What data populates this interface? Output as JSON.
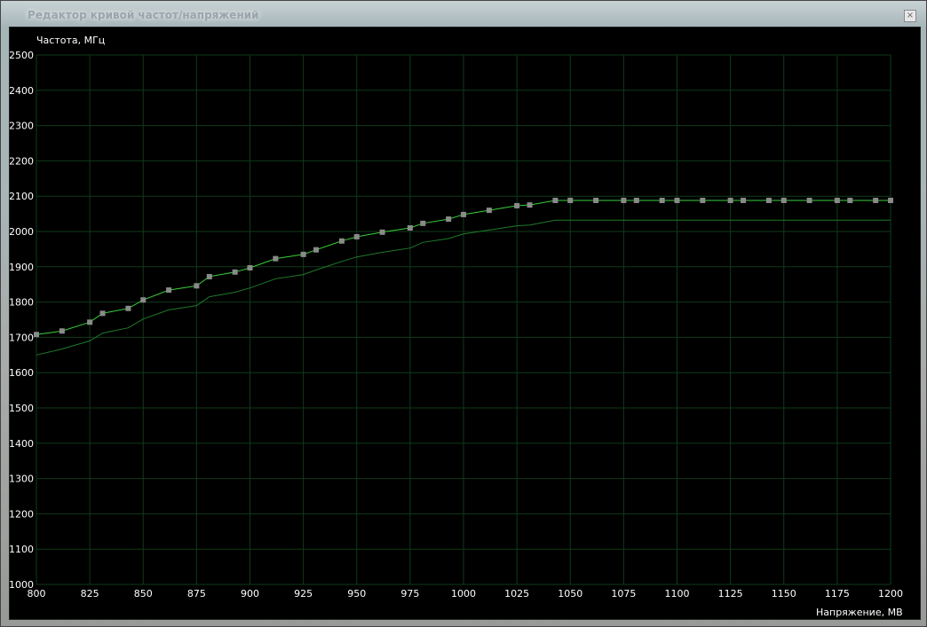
{
  "window": {
    "title": "Редактор кривой частот/напряжений",
    "close_glyph": "×"
  },
  "colors": {
    "background": "#000000",
    "grid": "#0f3a18",
    "main_curve": "#37d037",
    "base_curve": "#1f7a2a",
    "point": "#8a8a8a",
    "text": "#ffffff"
  },
  "chart_data": {
    "type": "line",
    "title": "",
    "ylabel": "Частота, МГц",
    "xlabel": "Напряжение, МВ",
    "xlim": [
      800,
      1200
    ],
    "ylim": [
      1000,
      2500
    ],
    "x_ticks": [
      800,
      825,
      850,
      875,
      900,
      925,
      950,
      975,
      1000,
      1025,
      1050,
      1075,
      1100,
      1125,
      1150,
      1175,
      1200
    ],
    "y_ticks": [
      1000,
      1100,
      1200,
      1300,
      1400,
      1500,
      1600,
      1700,
      1800,
      1900,
      2000,
      2100,
      2200,
      2300,
      2400,
      2500
    ],
    "grid": true,
    "series": [
      {
        "x": [
          800,
          812,
          825,
          831,
          843,
          850,
          862,
          875,
          881,
          893,
          900,
          912,
          925,
          931,
          943,
          950,
          962,
          975,
          981,
          993,
          1000,
          1012,
          1025,
          1031,
          1043,
          1050,
          1062,
          1075,
          1081,
          1093,
          1100,
          1112,
          1125,
          1131,
          1143,
          1150,
          1162,
          1175,
          1181,
          1193,
          1200
        ],
        "values": [
          1708,
          1718,
          1743,
          1768,
          1782,
          1806,
          1834,
          1846,
          1872,
          1885,
          1897,
          1923,
          1935,
          1948,
          1973,
          1985,
          1998,
          2010,
          2023,
          2035,
          2048,
          2060,
          2073,
          2075,
          2088,
          2088,
          2088,
          2088,
          2088,
          2088,
          2088,
          2088,
          2088,
          2088,
          2088,
          2088,
          2088,
          2088,
          2088,
          2088,
          2088
        ],
        "markers": true
      },
      {
        "x": [
          800,
          812,
          825,
          831,
          843,
          850,
          862,
          875,
          881,
          893,
          900,
          912,
          925,
          931,
          943,
          950,
          962,
          975,
          981,
          993,
          1000,
          1012,
          1025,
          1031,
          1043,
          1050,
          1062,
          1075,
          1081,
          1093,
          1100,
          1112,
          1125,
          1131,
          1143,
          1150,
          1162,
          1175,
          1181,
          1193,
          1200
        ],
        "values": [
          1650,
          1667,
          1690,
          1712,
          1727,
          1752,
          1778,
          1790,
          1815,
          1828,
          1840,
          1866,
          1878,
          1891,
          1915,
          1928,
          1941,
          1953,
          1969,
          1980,
          1993,
          2004,
          2016,
          2018,
          2032,
          2032,
          2032,
          2032,
          2032,
          2032,
          2032,
          2032,
          2032,
          2032,
          2032,
          2032,
          2032,
          2032,
          2032,
          2032,
          2032
        ],
        "markers": false
      }
    ]
  }
}
